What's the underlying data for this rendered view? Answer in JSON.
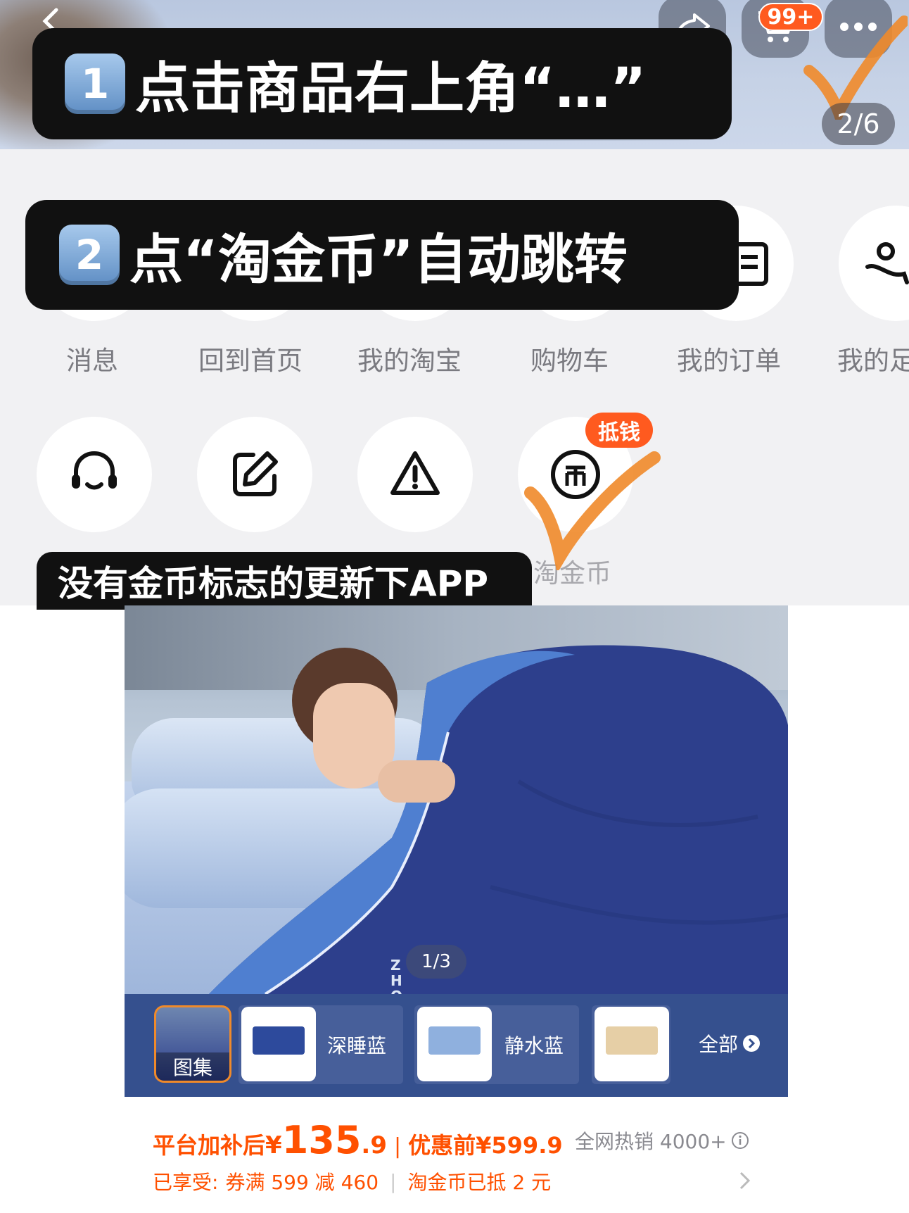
{
  "top_bar": {
    "cart_badge": "99+",
    "page_indicator": "2/6"
  },
  "steps": {
    "step1_number": "1",
    "step1_text": "点击商品右上角“…”",
    "step2_number": "2",
    "step2_text": "点“淘金币”自动跳转",
    "tip": "没有金币标志的更新下APP"
  },
  "menu_row1": [
    "消息",
    "回到首页",
    "我的淘宝",
    "购物车",
    "我的订单",
    "我的足"
  ],
  "menu_row2": {
    "icons": [
      "headset-icon",
      "edit-icon",
      "warning-icon",
      "coin-icon"
    ],
    "coin_badge": "抵钱",
    "coin_label": "淘金币"
  },
  "product": {
    "image_counter": "1/3",
    "brand_watermark": "ZHOTEL",
    "thumbnails": [
      {
        "label": "图集"
      },
      {
        "label": "深睡蓝"
      },
      {
        "label": "静水蓝"
      },
      {
        "label": ""
      }
    ],
    "all_label": "全部",
    "price_prefix": "平台加补后",
    "price_symbol": "¥",
    "price_int": "135",
    "price_dec": ".9",
    "orig_label": "优惠前",
    "orig_price": "¥599.9",
    "sales": "全网热销 4000+",
    "promo_prefix": "已享受:",
    "promo_coupon": "券满 599 减 460",
    "promo_coin": "淘金币已抵 2 元"
  },
  "colors": {
    "accent_orange": "#ff5000",
    "check_orange": "#f08a2a",
    "thumb_bar": "#35508e"
  }
}
